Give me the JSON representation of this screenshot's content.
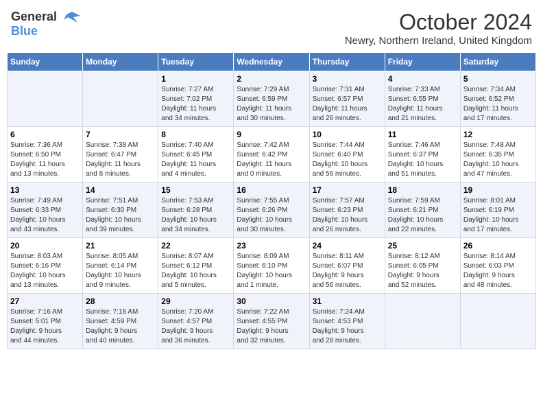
{
  "header": {
    "logo_general": "General",
    "logo_blue": "Blue",
    "month_title": "October 2024",
    "location": "Newry, Northern Ireland, United Kingdom"
  },
  "days_of_week": [
    "Sunday",
    "Monday",
    "Tuesday",
    "Wednesday",
    "Thursday",
    "Friday",
    "Saturday"
  ],
  "weeks": [
    [
      {
        "day": "",
        "info": ""
      },
      {
        "day": "",
        "info": ""
      },
      {
        "day": "1",
        "info": "Sunrise: 7:27 AM\nSunset: 7:02 PM\nDaylight: 11 hours\nand 34 minutes."
      },
      {
        "day": "2",
        "info": "Sunrise: 7:29 AM\nSunset: 6:59 PM\nDaylight: 11 hours\nand 30 minutes."
      },
      {
        "day": "3",
        "info": "Sunrise: 7:31 AM\nSunset: 6:57 PM\nDaylight: 11 hours\nand 26 minutes."
      },
      {
        "day": "4",
        "info": "Sunrise: 7:33 AM\nSunset: 6:55 PM\nDaylight: 11 hours\nand 21 minutes."
      },
      {
        "day": "5",
        "info": "Sunrise: 7:34 AM\nSunset: 6:52 PM\nDaylight: 11 hours\nand 17 minutes."
      }
    ],
    [
      {
        "day": "6",
        "info": "Sunrise: 7:36 AM\nSunset: 6:50 PM\nDaylight: 11 hours\nand 13 minutes."
      },
      {
        "day": "7",
        "info": "Sunrise: 7:38 AM\nSunset: 6:47 PM\nDaylight: 11 hours\nand 8 minutes."
      },
      {
        "day": "8",
        "info": "Sunrise: 7:40 AM\nSunset: 6:45 PM\nDaylight: 11 hours\nand 4 minutes."
      },
      {
        "day": "9",
        "info": "Sunrise: 7:42 AM\nSunset: 6:42 PM\nDaylight: 11 hours\nand 0 minutes."
      },
      {
        "day": "10",
        "info": "Sunrise: 7:44 AM\nSunset: 6:40 PM\nDaylight: 10 hours\nand 56 minutes."
      },
      {
        "day": "11",
        "info": "Sunrise: 7:46 AM\nSunset: 6:37 PM\nDaylight: 10 hours\nand 51 minutes."
      },
      {
        "day": "12",
        "info": "Sunrise: 7:48 AM\nSunset: 6:35 PM\nDaylight: 10 hours\nand 47 minutes."
      }
    ],
    [
      {
        "day": "13",
        "info": "Sunrise: 7:49 AM\nSunset: 6:33 PM\nDaylight: 10 hours\nand 43 minutes."
      },
      {
        "day": "14",
        "info": "Sunrise: 7:51 AM\nSunset: 6:30 PM\nDaylight: 10 hours\nand 39 minutes."
      },
      {
        "day": "15",
        "info": "Sunrise: 7:53 AM\nSunset: 6:28 PM\nDaylight: 10 hours\nand 34 minutes."
      },
      {
        "day": "16",
        "info": "Sunrise: 7:55 AM\nSunset: 6:26 PM\nDaylight: 10 hours\nand 30 minutes."
      },
      {
        "day": "17",
        "info": "Sunrise: 7:57 AM\nSunset: 6:23 PM\nDaylight: 10 hours\nand 26 minutes."
      },
      {
        "day": "18",
        "info": "Sunrise: 7:59 AM\nSunset: 6:21 PM\nDaylight: 10 hours\nand 22 minutes."
      },
      {
        "day": "19",
        "info": "Sunrise: 8:01 AM\nSunset: 6:19 PM\nDaylight: 10 hours\nand 17 minutes."
      }
    ],
    [
      {
        "day": "20",
        "info": "Sunrise: 8:03 AM\nSunset: 6:16 PM\nDaylight: 10 hours\nand 13 minutes."
      },
      {
        "day": "21",
        "info": "Sunrise: 8:05 AM\nSunset: 6:14 PM\nDaylight: 10 hours\nand 9 minutes."
      },
      {
        "day": "22",
        "info": "Sunrise: 8:07 AM\nSunset: 6:12 PM\nDaylight: 10 hours\nand 5 minutes."
      },
      {
        "day": "23",
        "info": "Sunrise: 8:09 AM\nSunset: 6:10 PM\nDaylight: 10 hours\nand 1 minute."
      },
      {
        "day": "24",
        "info": "Sunrise: 8:11 AM\nSunset: 6:07 PM\nDaylight: 9 hours\nand 56 minutes."
      },
      {
        "day": "25",
        "info": "Sunrise: 8:12 AM\nSunset: 6:05 PM\nDaylight: 9 hours\nand 52 minutes."
      },
      {
        "day": "26",
        "info": "Sunrise: 8:14 AM\nSunset: 6:03 PM\nDaylight: 9 hours\nand 48 minutes."
      }
    ],
    [
      {
        "day": "27",
        "info": "Sunrise: 7:16 AM\nSunset: 5:01 PM\nDaylight: 9 hours\nand 44 minutes."
      },
      {
        "day": "28",
        "info": "Sunrise: 7:18 AM\nSunset: 4:59 PM\nDaylight: 9 hours\nand 40 minutes."
      },
      {
        "day": "29",
        "info": "Sunrise: 7:20 AM\nSunset: 4:57 PM\nDaylight: 9 hours\nand 36 minutes."
      },
      {
        "day": "30",
        "info": "Sunrise: 7:22 AM\nSunset: 4:55 PM\nDaylight: 9 hours\nand 32 minutes."
      },
      {
        "day": "31",
        "info": "Sunrise: 7:24 AM\nSunset: 4:53 PM\nDaylight: 9 hours\nand 28 minutes."
      },
      {
        "day": "",
        "info": ""
      },
      {
        "day": "",
        "info": ""
      }
    ]
  ]
}
